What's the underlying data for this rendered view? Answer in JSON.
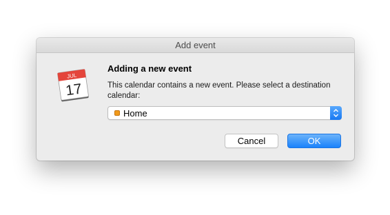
{
  "window": {
    "title": "Add event"
  },
  "app_icon": {
    "name": "calendar-icon",
    "month": "JUL",
    "day": "17",
    "header_color": "#e4453b"
  },
  "dialog": {
    "heading": "Adding a new event",
    "message": "This calendar contains a new event. Please select a destination calendar:"
  },
  "calendar_select": {
    "selected": "Home",
    "swatch_color": "#f19a1b",
    "icon": "chevron-updown-icon"
  },
  "buttons": {
    "cancel_label": "Cancel",
    "ok_label": "OK"
  },
  "colors": {
    "accent": "#1a82fb",
    "dialog_bg": "#ececec"
  }
}
